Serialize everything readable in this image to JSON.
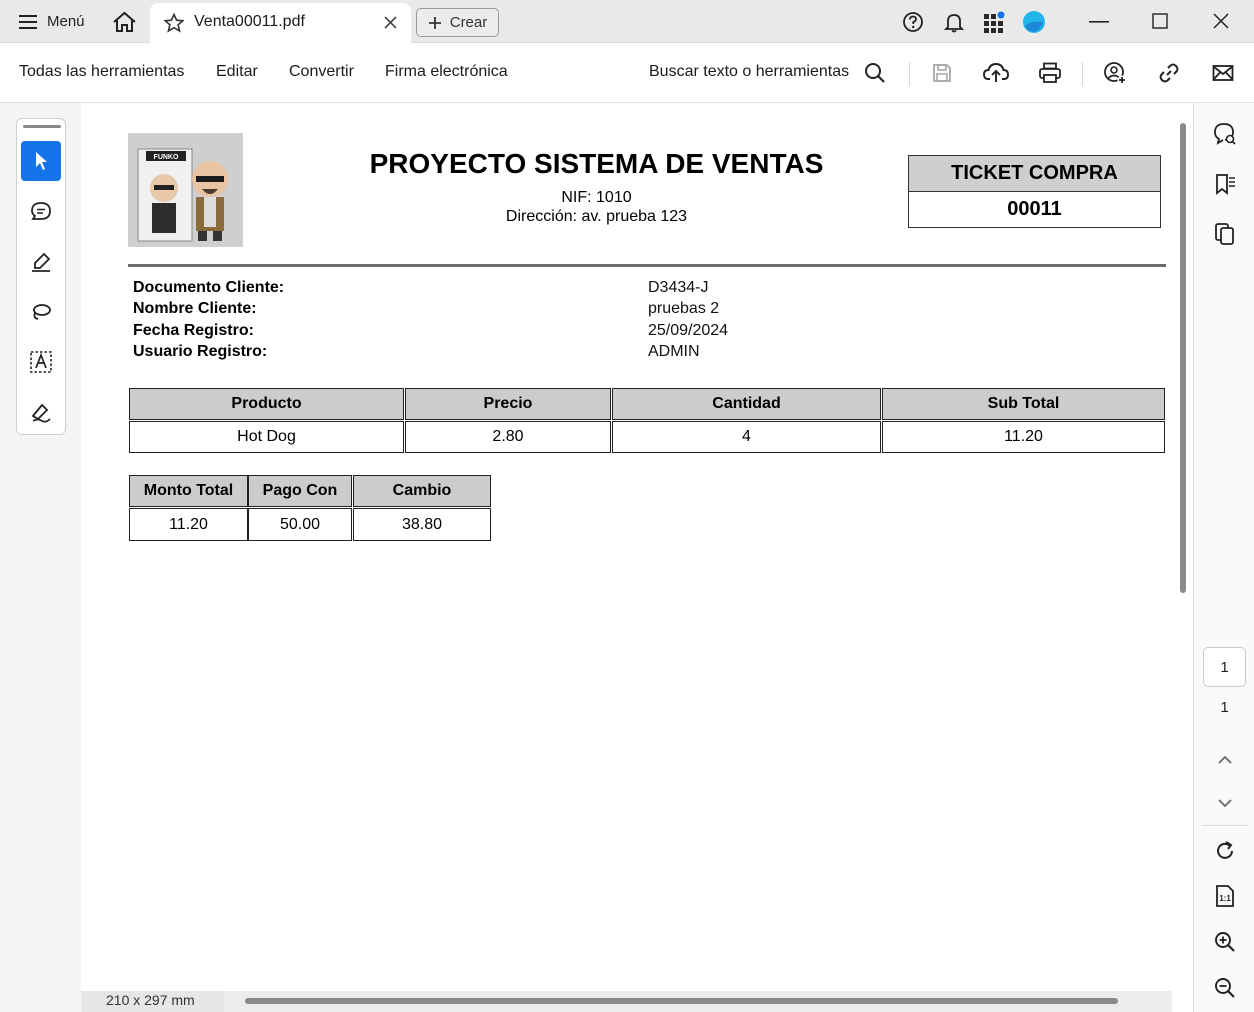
{
  "titlebar": {
    "menu_label": "Menú",
    "tab_title": "Venta00011.pdf",
    "crear_label": "Crear"
  },
  "toolbar": {
    "items": [
      "Todas las herramientas",
      "Editar",
      "Convertir",
      "Firma electrónica"
    ],
    "search_label": "Buscar texto o herramientas"
  },
  "document": {
    "title": "PROYECTO SISTEMA DE VENTAS",
    "nif": "NIF: 1010",
    "address": "Dirección: av. prueba 123",
    "ticket_label": "TICKET COMPRA",
    "ticket_number": "00011",
    "info": [
      {
        "label": "Documento Cliente:",
        "value": "D3434-J"
      },
      {
        "label": "Nombre Cliente:",
        "value": "pruebas 2"
      },
      {
        "label": "Fecha Registro:",
        "value": "25/09/2024"
      },
      {
        "label": "Usuario Registro:",
        "value": "ADMIN"
      }
    ],
    "products_table": {
      "headers": [
        "Producto",
        "Precio",
        "Cantidad",
        "Sub Total"
      ],
      "rows": [
        [
          "Hot Dog",
          "2.80",
          "4",
          "11.20"
        ]
      ]
    },
    "totals_table": {
      "headers": [
        "Monto Total",
        "Pago Con",
        "Cambio"
      ],
      "values": [
        "11.20",
        "50.00",
        "38.80"
      ]
    },
    "logo_text": "FUNKO"
  },
  "pagenav": {
    "current_page": "1",
    "total_pages": "1"
  },
  "status": {
    "page_size": "210 x 297 mm"
  },
  "colors": {
    "accent": "#1473e6",
    "table_header": "#cccccc"
  }
}
